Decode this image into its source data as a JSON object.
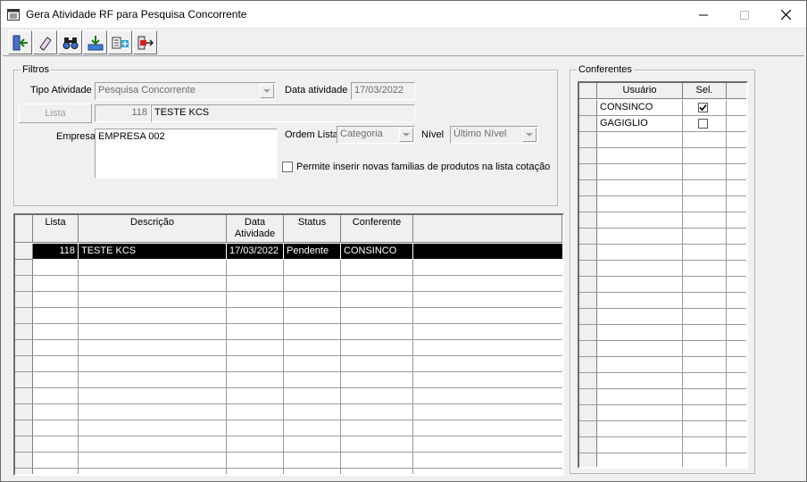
{
  "window": {
    "title": "Gera Atividade RF para Pesquisa Concorrente"
  },
  "toolbar": {
    "buttons": [
      {
        "icon": "exit-door-icon"
      },
      {
        "icon": "eraser-icon"
      },
      {
        "icon": "binoculars-icon"
      },
      {
        "icon": "import-tray-icon"
      },
      {
        "icon": "add-activity-icon"
      },
      {
        "icon": "export-arrow-icon"
      }
    ]
  },
  "filters": {
    "group_label": "Filtros",
    "tipo_atividade_label": "Tipo Atividade",
    "tipo_atividade_value": "Pesquisa Concorrente",
    "data_atividade_label": "Data atividade",
    "data_atividade_value": "17/03/2022",
    "lista_button": "Lista",
    "lista_code": "118",
    "lista_name": "TESTE KCS",
    "empresa_label": "Empresa",
    "empresa_value": "EMPRESA 002",
    "ordem_lista_label": "Ordem Lista",
    "ordem_lista_value": "Categoria",
    "nivel_label": "Nível",
    "nivel_value": "Último Nível",
    "permite_label": "Permite inserir novas familias de produtos na lista cotação",
    "permite_checked": false
  },
  "activities": {
    "columns": [
      "Lista",
      "Descrição",
      "Data Atividade",
      "Status",
      "Conferente"
    ],
    "rows": [
      {
        "lista": "118",
        "descricao": "TESTE KCS",
        "data": "17/03/2022",
        "status": "Pendente",
        "conferente": "CONSINCO",
        "selected": true
      }
    ]
  },
  "conferentes": {
    "group_label": "Conferentes",
    "columns": [
      "Usuário",
      "Sel."
    ],
    "rows": [
      {
        "usuario": "CONSINCO",
        "sel": true
      },
      {
        "usuario": "GAGIGLIO",
        "sel": false
      }
    ]
  },
  "colors": {
    "selection": "#000000",
    "window_bg": "#f0f0f0"
  }
}
